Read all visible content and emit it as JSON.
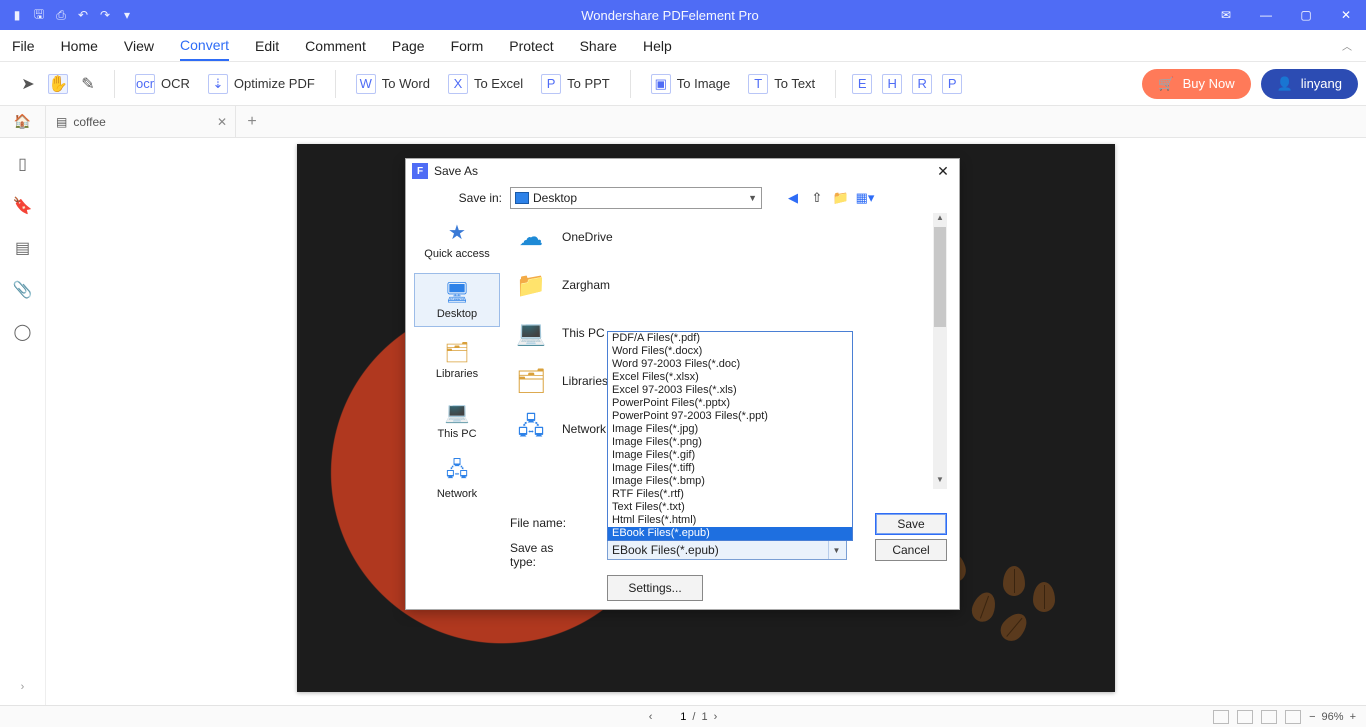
{
  "app_title": "Wondershare PDFelement Pro",
  "menus": [
    "File",
    "Home",
    "View",
    "Convert",
    "Edit",
    "Comment",
    "Page",
    "Form",
    "Protect",
    "Share",
    "Help"
  ],
  "active_menu": "Convert",
  "ribbon": {
    "ocr": "OCR",
    "optimize": "Optimize PDF",
    "to_word": "To Word",
    "to_excel": "To Excel",
    "to_ppt": "To PPT",
    "to_image": "To Image",
    "to_text": "To Text"
  },
  "buy_now": "Buy Now",
  "username": "linyang",
  "tab_name": "coffee",
  "dialog": {
    "title": "Save As",
    "save_in_label": "Save in:",
    "save_in_value": "Desktop",
    "places": [
      "Quick access",
      "Desktop",
      "Libraries",
      "This PC",
      "Network"
    ],
    "selected_place": "Desktop",
    "items": [
      "OneDrive",
      "Zargham",
      "This PC",
      "Libraries",
      "Network"
    ],
    "file_name_label": "File name:",
    "file_name_value": "",
    "save_type_label": "Save as type:",
    "save_type_value": "EBook Files(*.epub)",
    "type_options": [
      "PDF/A Files(*.pdf)",
      "Word Files(*.docx)",
      "Word 97-2003 Files(*.doc)",
      "Excel Files(*.xlsx)",
      "Excel 97-2003 Files(*.xls)",
      "PowerPoint Files(*.pptx)",
      "PowerPoint 97-2003 Files(*.ppt)",
      "Image Files(*.jpg)",
      "Image Files(*.png)",
      "Image Files(*.gif)",
      "Image Files(*.tiff)",
      "Image Files(*.bmp)",
      "RTF Files(*.rtf)",
      "Text Files(*.txt)",
      "Html Files(*.html)",
      "EBook Files(*.epub)"
    ],
    "selected_type_index": 15,
    "save_btn": "Save",
    "cancel_btn": "Cancel",
    "settings_btn": "Settings..."
  },
  "status": {
    "page_current": "1",
    "page_sep": "/",
    "page_total": "1",
    "zoom": "96%"
  }
}
